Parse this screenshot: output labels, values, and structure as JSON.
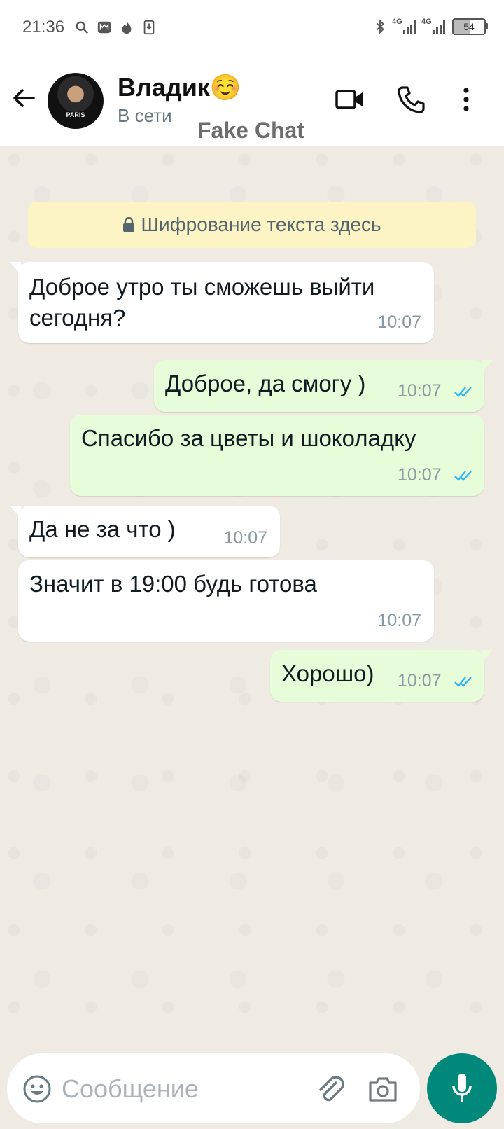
{
  "status_bar": {
    "time": "21:36",
    "network_1": "4G",
    "network_2": "4G",
    "battery": "54"
  },
  "header": {
    "contact_name": "Владик☺️",
    "contact_status": "В сети",
    "watermark": "Fake Chat",
    "avatar_text": "PARIS"
  },
  "chat": {
    "encryption_notice": "Шифрование текста здесь",
    "messages": [
      {
        "direction": "in",
        "text_line1": "Доброе утро ты сможешь выйти",
        "text_line2": "сегодня?",
        "time": "10:07"
      },
      {
        "direction": "out",
        "text": "Доброе, да смогу )",
        "time": "10:07",
        "status": "read"
      },
      {
        "direction": "out",
        "text": "Спасибо за цветы и шоколадку",
        "time": "10:07",
        "status": "read"
      },
      {
        "direction": "in",
        "text": "Да не за что )",
        "time": "10:07"
      },
      {
        "direction": "in",
        "text": "Значит в 19:00 будь готова",
        "time": "10:07"
      },
      {
        "direction": "out",
        "text": "Хорошо)",
        "time": "10:07",
        "status": "read"
      }
    ]
  },
  "composer": {
    "placeholder": "Сообщение"
  },
  "colors": {
    "accent": "#00897b",
    "outgoing_bubble": "#e7fcd8",
    "incoming_bubble": "#ffffff",
    "read_ticks": "#34b7f1",
    "chat_background": "#efeae2"
  }
}
